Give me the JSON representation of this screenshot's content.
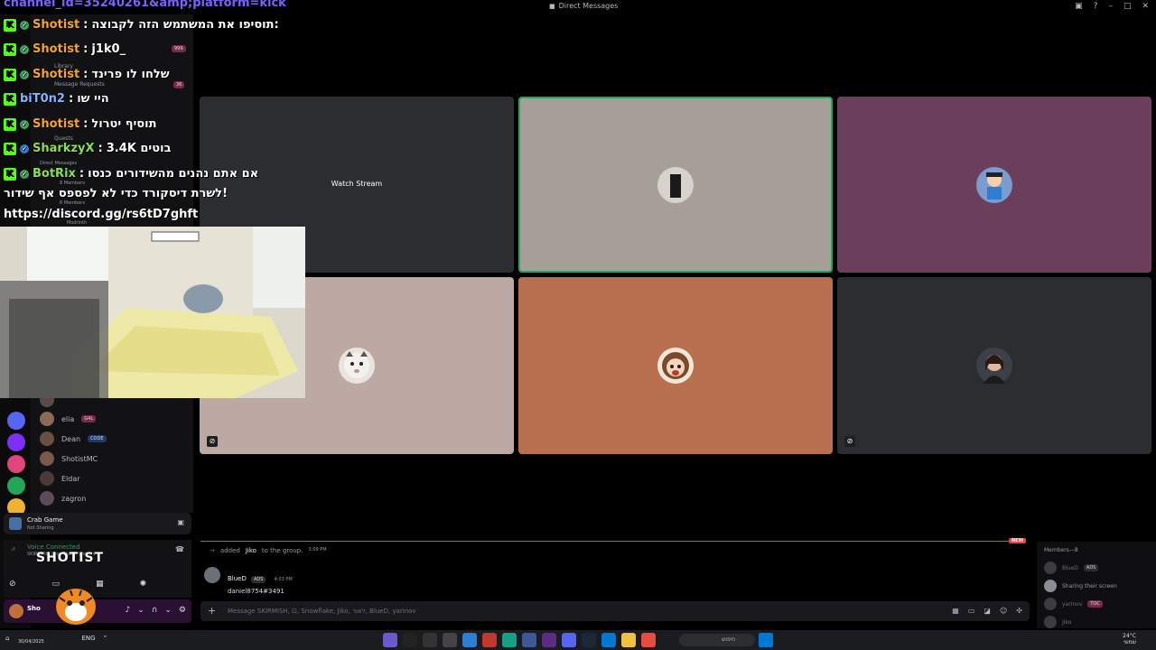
{
  "window": {
    "title": "Direct Messages"
  },
  "url_overlay": "channel_id=35240261&amp;platform=kick",
  "chat_overlay": [
    {
      "user": "Shotist",
      "text": "תוסיפו את המשתמש הזה לקבוצה:",
      "color": "#f5a623"
    },
    {
      "user": "Shotist",
      "text": "j1k0_",
      "color": "#f5a623"
    },
    {
      "user": "Shotist",
      "text": "שלחו לו פרינד",
      "color": "#f5a623"
    },
    {
      "user": "biT0n2",
      "text": "היי שו",
      "color": "#7fb6ff"
    },
    {
      "user": "Shotist",
      "text": "תוסיף יטרול",
      "color": "#f5a623"
    },
    {
      "user": "SharkzyX",
      "text": "3.4K בוטים",
      "color": "#8ce04a"
    },
    {
      "user": "BotRix",
      "text": "אם אתם נהנים מהשידורים כנסו",
      "color": "#8ce04a"
    }
  ],
  "chat_continued": [
    "לשרת דיסקורד כדי לא לפספס אף שידור!",
    "https://discord.gg/rs6tD7ghft"
  ],
  "dm_list_hidden": {
    "library": "Library",
    "message_requests": "Message Requests",
    "message_requests_count": "36",
    "badge_count": "999",
    "quests": "Quests",
    "direct_messages": "Direct Messages",
    "group_members_a": "8 Members",
    "group_members_b": "6 Members",
    "modrinth": "Modrinth"
  },
  "members_list": [
    {
      "name": "elia",
      "tag": "G4L"
    },
    {
      "name": "Dean",
      "tag": "CODE"
    },
    {
      "name": "ShotistMC",
      "tag": ""
    },
    {
      "name": "Eldar",
      "tag": ""
    },
    {
      "name": "zagron",
      "tag": ""
    }
  ],
  "video_tiles": [
    {
      "bg": "#2b2d31",
      "watch_stream": "Watch Stream"
    },
    {
      "bg": "#a59f98",
      "highlight": true
    },
    {
      "bg": "#6b3f5b"
    },
    {
      "bg": "#bda9a4"
    },
    {
      "bg": "#b8704e"
    },
    {
      "bg": "#2b2d31"
    }
  ],
  "bottom_chat": {
    "new_badge": "NEW",
    "system": {
      "actor": "added",
      "target": "Jiko",
      "suffix": "to the group.",
      "time": "3:09 PM"
    },
    "message": {
      "author": "BlueD",
      "badge": "ADS",
      "time": "4:03 PM",
      "body": "daniel8754#3491"
    },
    "composer_placeholder": "Message SKIRMISH, ⊡, Snowflake, Jiko, לאור, BlueD, yarinov"
  },
  "members_panel": {
    "header": "Members—8",
    "rows": [
      {
        "name": "BlueD",
        "tag": "ADS",
        "status": ""
      },
      {
        "name": "",
        "tag": "",
        "status": "Sharing their screen"
      },
      {
        "name": "yarinov",
        "tag": "TOC",
        "status": ""
      },
      {
        "name": "Jiko",
        "tag": "",
        "status": ""
      }
    ]
  },
  "activity": {
    "title": "Crab Game",
    "subtitle": "Not Sharing"
  },
  "voice": {
    "status": "Voice Connected",
    "channel": "SKIRMISH, Jiko, BlueD, yarinov"
  },
  "stream_logo": "SHOTIST",
  "user_panel": {
    "name": "Sho"
  },
  "taskbar": {
    "search_label": "חיפוש",
    "lang": "ENG",
    "date": "30/04/2025",
    "weather_temp": "24°C",
    "weather_desc": "שמשי"
  },
  "colors": {
    "accent_green": "#23a55a",
    "danger": "#f23f43",
    "kick_green": "#53fc18"
  }
}
